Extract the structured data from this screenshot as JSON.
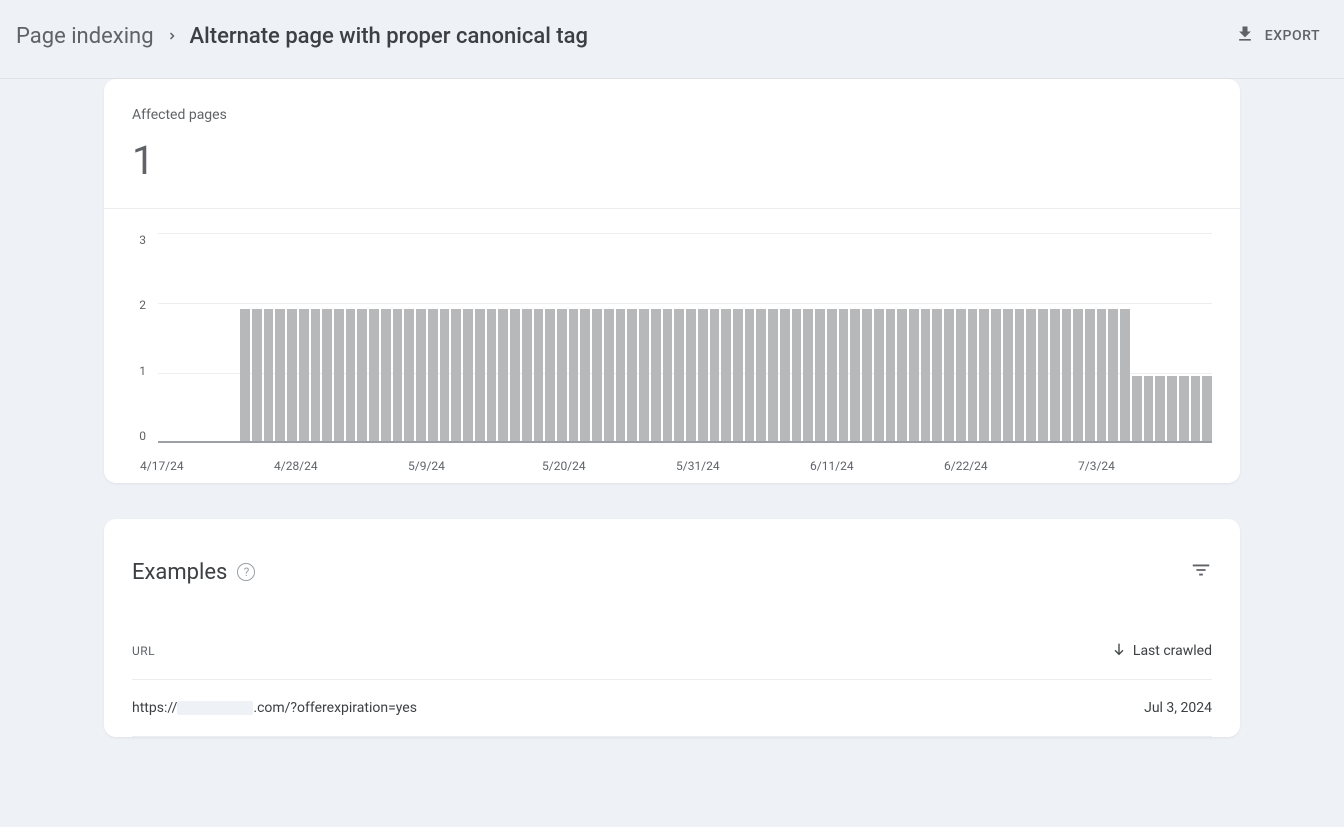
{
  "breadcrumb": {
    "parent": "Page indexing",
    "current": "Alternate page with proper canonical tag"
  },
  "export_label": "EXPORT",
  "affected": {
    "label": "Affected pages",
    "value": "1"
  },
  "chart_data": {
    "type": "bar",
    "ylabel": "",
    "xlabel": "",
    "ylim": [
      0,
      3
    ],
    "y_ticks": [
      "3",
      "2",
      "1",
      "0"
    ],
    "x_ticks": [
      "4/17/24",
      "4/28/24",
      "5/9/24",
      "5/20/24",
      "5/31/24",
      "6/11/24",
      "6/22/24",
      "7/3/24"
    ],
    "values": [
      0,
      0,
      0,
      0,
      0,
      0,
      0,
      2,
      2,
      2,
      2,
      2,
      2,
      2,
      2,
      2,
      2,
      2,
      2,
      2,
      2,
      2,
      2,
      2,
      2,
      2,
      2,
      2,
      2,
      2,
      2,
      2,
      2,
      2,
      2,
      2,
      2,
      2,
      2,
      2,
      2,
      2,
      2,
      2,
      2,
      2,
      2,
      2,
      2,
      2,
      2,
      2,
      2,
      2,
      2,
      2,
      2,
      2,
      2,
      2,
      2,
      2,
      2,
      2,
      2,
      2,
      2,
      2,
      2,
      2,
      2,
      2,
      2,
      2,
      2,
      2,
      2,
      2,
      2,
      2,
      2,
      2,
      2,
      1,
      1,
      1,
      1,
      1,
      1,
      1
    ]
  },
  "examples": {
    "title": "Examples",
    "columns": {
      "url": "URL",
      "crawled": "Last crawled"
    },
    "rows": [
      {
        "url_prefix": "https://",
        "url_redacted": true,
        "url_suffix": ".com/?offerexpiration=yes",
        "crawled": "Jul 3, 2024"
      }
    ]
  }
}
